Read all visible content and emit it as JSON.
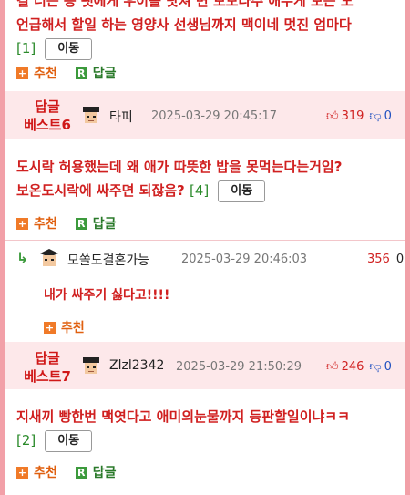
{
  "comments": {
    "top": {
      "line1": "걸 너는 등 팻에게 우이를 낫쳐 면 보모다주 애누게 보는 도",
      "line2": "언급해서 할일 하는 영양사 선생님까지 맥이네 멋진 엄마다",
      "count": "[1]",
      "move_label": "이동",
      "recommend_label": "추천",
      "reply_label": "답글"
    },
    "best6": {
      "badge_line1": "답글",
      "badge_line2": "베스트6",
      "nickname": "타피",
      "datetime": "2025-03-29 20:45:17",
      "up_count": "319",
      "down_count": "0",
      "line1": "도시락 허용했는데 왜 애가 따뜻한 밥을 못먹는다는거임?",
      "line2": "보온도시락에 싸주면 되잖음?",
      "count": "[4]",
      "move_label": "이동",
      "recommend_label": "추천",
      "reply_label": "답글"
    },
    "reply": {
      "nickname": "모쏠도결혼가능",
      "datetime": "2025-03-29 20:46:03",
      "up_count": "356",
      "down_count": "0",
      "text": "내가 싸주기 싫다고!!!!",
      "recommend_label": "추천"
    },
    "best7": {
      "badge_line1": "답글",
      "badge_line2": "베스트7",
      "nickname": "Zlzl2342",
      "datetime": "2025-03-29 21:50:29",
      "up_count": "246",
      "down_count": "0",
      "line1": "지새끼 빵한번 맥엿다고 애미의눈물까지 등판할일이냐ㅋㅋ",
      "count": "[2]",
      "move_label": "이동",
      "recommend_label": "추천",
      "reply_label": "답글"
    }
  },
  "colors": {
    "border": "#f2a0a8",
    "best_band": "#fde8ea",
    "accent_red": "#d02020",
    "reply_green": "#3c9a3c",
    "recommend_orange": "#f07a28"
  }
}
